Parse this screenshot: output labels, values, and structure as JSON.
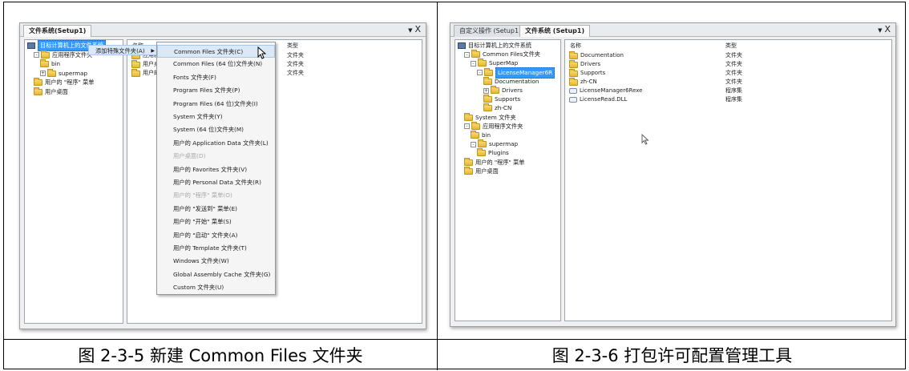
{
  "left": {
    "tabs": [
      "文件系统(Setup1)"
    ],
    "close_glyph": "▾ X",
    "tree": {
      "root": "目标计算机上的文件系统",
      "items": [
        {
          "label": "应用程序文件夹",
          "indent": 1,
          "expander": "-"
        },
        {
          "label": "bin",
          "indent": 2
        },
        {
          "label": "supermap",
          "indent": 2,
          "expander": "+"
        },
        {
          "label": "用户的 \"程序\" 菜单",
          "indent": 1
        },
        {
          "label": "用户桌面",
          "indent": 1
        }
      ]
    },
    "list": {
      "col_name": "名称",
      "col_type": "类型",
      "rows": [
        {
          "name": "应用程序文件夹",
          "type": "文件夹"
        },
        {
          "name": "用户桌面",
          "type": "文件夹"
        },
        {
          "name": "用户的 \"程序\" 菜单",
          "type": "文件夹"
        }
      ]
    },
    "context_menu": {
      "parent_item": "添加特殊文件夹(A)",
      "items": [
        {
          "label": "Common Files 文件夹(C)",
          "highlighted": true
        },
        {
          "label": "Common Files (64 位)文件夹(N)"
        },
        {
          "label": "Fonts 文件夹(F)"
        },
        {
          "label": "Program Files 文件夹(P)"
        },
        {
          "label": "Program Files (64 位)文件夹(I)"
        },
        {
          "label": "System 文件夹(Y)"
        },
        {
          "label": "System (64 位)文件夹(M)"
        },
        {
          "label": "用户的 Application Data 文件夹(L)"
        },
        {
          "label": "用户桌面(D)",
          "disabled": true
        },
        {
          "label": "用户的 Favorites 文件夹(V)"
        },
        {
          "label": "用户的 Personal Data 文件夹(R)"
        },
        {
          "label": "用户的 \"程序\" 菜单(O)",
          "disabled": true
        },
        {
          "label": "用户的 \"发送到\" 菜单(E)"
        },
        {
          "label": "用户的 \"开始\" 菜单(S)"
        },
        {
          "label": "用户的 \"启动\" 文件夹(A)"
        },
        {
          "label": "用户的 Template 文件夹(T)"
        },
        {
          "label": "Windows 文件夹(W)"
        },
        {
          "label": "Global Assembly Cache 文件夹(G)"
        },
        {
          "label": "Custom 文件夹(U)"
        }
      ]
    },
    "caption": "图 2-3-5 新建 Common Files 文件夹"
  },
  "right": {
    "tabs": [
      "自定义操作 (Setup1)",
      "文件系统 (Setup1)"
    ],
    "close_glyph": "▾ X",
    "tree": {
      "root": "目标计算机上的文件系统",
      "items": [
        {
          "label": "Common Files文件夹",
          "indent": 1,
          "expander": "-"
        },
        {
          "label": "SuperMap",
          "indent": 2,
          "expander": "-"
        },
        {
          "label": "LicenseManager6R",
          "indent": 3,
          "expander": "-",
          "selected": true
        },
        {
          "label": "Documentation",
          "indent": 4
        },
        {
          "label": "Drivers",
          "indent": 4,
          "expander": "+"
        },
        {
          "label": "Supports",
          "indent": 4
        },
        {
          "label": "zh-CN",
          "indent": 4
        },
        {
          "label": "System 文件夹",
          "indent": 1
        },
        {
          "label": "应用程序文件夹",
          "indent": 1,
          "expander": "-"
        },
        {
          "label": "bin",
          "indent": 2
        },
        {
          "label": "supermap",
          "indent": 2,
          "expander": "-"
        },
        {
          "label": "Plugins",
          "indent": 3
        },
        {
          "label": "用户的 \"程序\" 菜单",
          "indent": 1
        },
        {
          "label": "用户桌面",
          "indent": 1
        }
      ]
    },
    "list": {
      "col_name": "名称",
      "col_type": "类型",
      "rows": [
        {
          "name": "Documentation",
          "type": "文件夹",
          "icon": "folder"
        },
        {
          "name": "Drivers",
          "type": "文件夹",
          "icon": "folder"
        },
        {
          "name": "Supports",
          "type": "文件夹",
          "icon": "folder"
        },
        {
          "name": "zh-CN",
          "type": "文件夹",
          "icon": "folder"
        },
        {
          "name": "LicenseManager6Rexe",
          "type": "程序集",
          "icon": "file"
        },
        {
          "name": "LicenseRead.DLL",
          "type": "程序集",
          "icon": "file"
        }
      ]
    },
    "caption": "图 2-3-6 打包许可配置管理工具"
  },
  "colors": {
    "selection": "#3399ff",
    "menu_highlight": "#dbe9f7",
    "folder": "#f0c84a"
  }
}
